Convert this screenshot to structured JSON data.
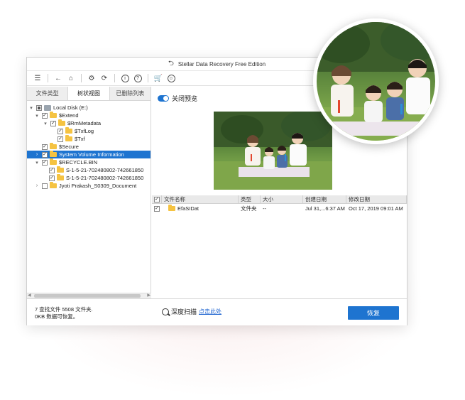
{
  "window": {
    "title": "Stellar Data Recovery Free Edition"
  },
  "tabs": [
    {
      "label": "文件类型"
    },
    {
      "label": "树状视图",
      "active": true
    },
    {
      "label": "已删除列表"
    }
  ],
  "tree": [
    {
      "label": "Local Disk (E:)"
    },
    {
      "label": "$Extend"
    },
    {
      "label": "$RmMetadata"
    },
    {
      "label": "$TxfLog"
    },
    {
      "label": "$Txf"
    },
    {
      "label": "$Secure"
    },
    {
      "label": "System Volume Information",
      "selected": true
    },
    {
      "label": "$RECYCLE.BIN"
    },
    {
      "label": "S-1-5-21-702480802-742661850"
    },
    {
      "label": "S-1-5-21-702480802-742661850"
    },
    {
      "label": "Jyoti Prakash_S0309_Document"
    }
  ],
  "preview": {
    "toggle_label": "关闭预览"
  },
  "table": {
    "headers": [
      "文件名称",
      "类型",
      "大小",
      "创建日期",
      "修改日期"
    ],
    "rows": [
      {
        "name": "EfaSIDat",
        "type": "文件夹",
        "size": "--",
        "created": "Jul 31,...6:37 AM",
        "modified": "Oct 17, 2019 09:01 AM"
      }
    ]
  },
  "status": {
    "line1": "7 查找文件 5508 文件夹.",
    "line2": "0KB 数据可恢复。"
  },
  "deep_scan": {
    "label": "深度扫描",
    "link": "点击此处"
  },
  "recover_button": "恢复",
  "colors": {
    "accent": "#1e74d0",
    "folder": "#f5c342"
  },
  "icons": [
    "menu-icon",
    "back-arrow-icon",
    "home-icon",
    "settings-icon",
    "scan-icon",
    "info-icon",
    "help-icon",
    "cart-icon",
    "user-icon"
  ]
}
